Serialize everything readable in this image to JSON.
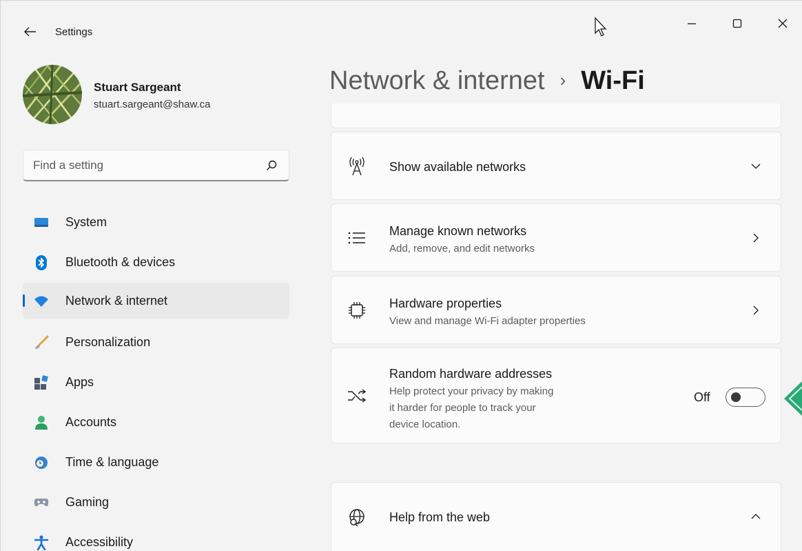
{
  "titlebar": {
    "app_title": "Settings",
    "back_icon": "arrow-left-icon",
    "controls": [
      "minimize-icon",
      "maximize-icon",
      "close-icon"
    ]
  },
  "profile": {
    "name": "Stuart Sargeant",
    "email": "stuart.sargeant@shaw.ca"
  },
  "search": {
    "placeholder": "Find a setting",
    "value": ""
  },
  "nav": {
    "items": [
      {
        "label": "System",
        "icon": "monitor-icon",
        "selected": false
      },
      {
        "label": "Bluetooth & devices",
        "icon": "bluetooth-icon",
        "selected": false
      },
      {
        "label": "Network & internet",
        "icon": "wifi-icon",
        "selected": true
      },
      {
        "label": "Personalization",
        "icon": "brush-icon",
        "selected": false
      },
      {
        "label": "Apps",
        "icon": "apps-icon",
        "selected": false
      },
      {
        "label": "Accounts",
        "icon": "person-icon",
        "selected": false
      },
      {
        "label": "Time & language",
        "icon": "clock-globe-icon",
        "selected": false
      },
      {
        "label": "Gaming",
        "icon": "gamepad-icon",
        "selected": false
      },
      {
        "label": "Accessibility",
        "icon": "accessibility-icon",
        "selected": false
      }
    ]
  },
  "header": {
    "parent": "Network & internet",
    "separator": "›",
    "current": "Wi-Fi"
  },
  "cards": {
    "show_networks": {
      "title": "Show available networks",
      "icon": "antenna-icon"
    },
    "manage_known": {
      "title": "Manage known networks",
      "subtitle": "Add, remove, and edit networks",
      "icon": "list-icon"
    },
    "hardware": {
      "title": "Hardware properties",
      "subtitle": "View and manage Wi-Fi adapter properties",
      "icon": "chip-icon"
    },
    "random_mac": {
      "title": "Random hardware addresses",
      "subtitle_lines": [
        "Help protect your privacy by making",
        "it harder for people to track your",
        "device location."
      ],
      "toggle_label": "Off",
      "toggle_on": false,
      "icon": "shuffle-icon"
    },
    "help_web": {
      "title": "Help from the web",
      "icon": "globe-search-icon"
    }
  },
  "colors": {
    "accent": "#0067c0",
    "window_bg": "#f3f3f3",
    "card_bg": "#fbfbfb",
    "callout": "#2aa877"
  }
}
